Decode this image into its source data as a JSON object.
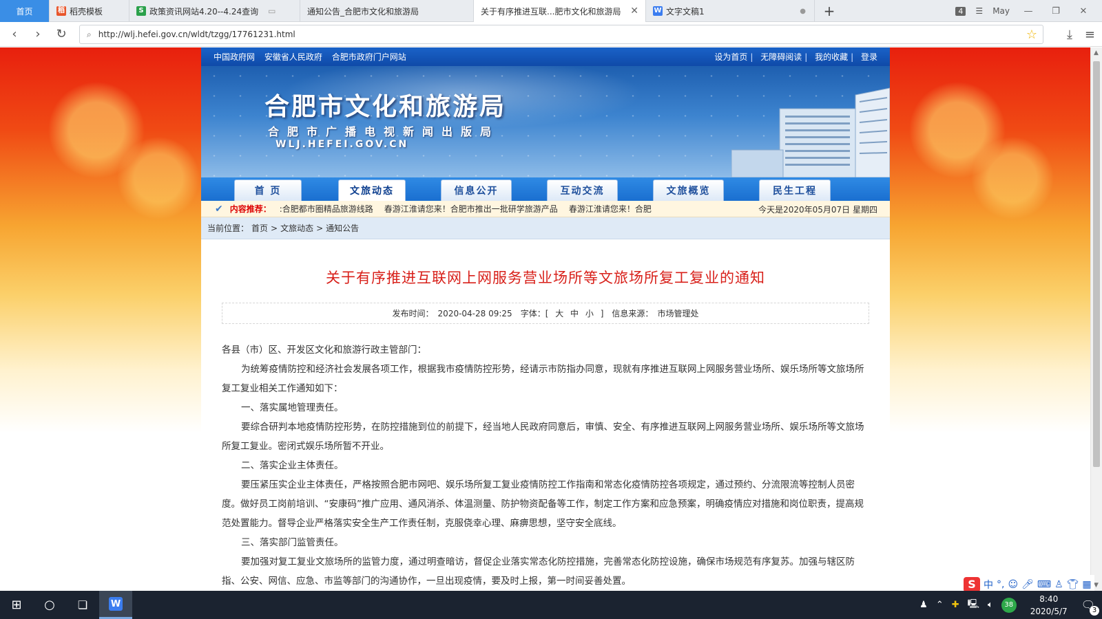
{
  "browser": {
    "tabs": [
      {
        "label": "首页",
        "icon": "home-tab"
      },
      {
        "label": "稻壳模板",
        "icon": "docer-icon"
      },
      {
        "label": "政策资讯网站4.20--4.24查询",
        "icon": "spreadsheet-icon"
      },
      {
        "label": "通知公告_合肥市文化和旅游局",
        "icon": "page-icon"
      },
      {
        "label": "关于有序推进互联...肥市文化和旅游局",
        "icon": "page-icon"
      },
      {
        "label": "文字文稿1",
        "icon": "writer-icon"
      }
    ],
    "new_tab": "+",
    "tab_count": "4",
    "account": "May",
    "url": "http://wlj.hefei.gov.cn/wldt/tzgg/17761231.html"
  },
  "site": {
    "top_links": [
      "中国政府网",
      "安徽省人民政府",
      "合肥市政府门户网站"
    ],
    "top_right": [
      "设为首页",
      "无障碍阅读",
      "我的收藏",
      "登录"
    ],
    "banner": {
      "title": "合肥市文化和旅游局",
      "subtitle": "合肥市广播电视新闻出版局",
      "domain": "WLJ.HEFEI.GOV.CN"
    },
    "nav": [
      "首 页",
      "文旅动态",
      "信息公开",
      "互动交流",
      "文旅概览",
      "民生工程"
    ],
    "nav_active_index": 1,
    "ticker": {
      "label": "内容推荐：",
      "items": [
        ":合肥都市圈精品旅游线路",
        "春游江淮请您来！合肥市推出一批研学旅游产品",
        "春游江淮请您来！合肥"
      ],
      "date": "今天是2020年05月07日 星期四"
    },
    "breadcrumb": [
      "当前位置：",
      "首页",
      ">",
      "文旅动态",
      ">",
      "通知公告"
    ]
  },
  "article": {
    "title": "关于有序推进互联网上网服务营业场所等文旅场所复工复业的通知",
    "meta": {
      "publish_label": "发布时间：",
      "publish_time": "2020-04-28 09:25",
      "font_label": "字体：[",
      "font_sizes": [
        "大",
        "中",
        "小"
      ],
      "font_close": "]",
      "source_label": "信息来源：",
      "source": "市场管理处"
    },
    "paragraphs": [
      "各县（市）区、开发区文化和旅游行政主管部门：",
      "为统筹疫情防控和经济社会发展各项工作，根据我市疫情防控形势，经请示市防指办同意，现就有序推进互联网上网服务营业场所、娱乐场所等文旅场所复工复业相关工作通知如下：",
      "一、落实属地管理责任。",
      "要综合研判本地疫情防控形势，在防控措施到位的前提下，经当地人民政府同意后，审慎、安全、有序推进互联网上网服务营业场所、娱乐场所等文旅场所复工复业。密闭式娱乐场所暂不开业。",
      "二、落实企业主体责任。",
      "要压紧压实企业主体责任，严格按照合肥市网吧、娱乐场所复工复业疫情防控工作指南和常态化疫情防控各项规定，通过预约、分流限流等控制人员密度。做好员工岗前培训、“安康码”推广应用、通风消杀、体温测量、防护物资配备等工作，制定工作方案和应急预案，明确疫情应对措施和岗位职责，提高规范处置能力。督导企业严格落实安全生产工作责任制，克服侥幸心理、麻痹思想，坚守安全底线。",
      "三、落实部门监管责任。",
      "要加强对复工复业文旅场所的监管力度，通过明查暗访，督促企业落实常态化防控措施，完善常态化防控设施，确保市场规范有序复苏。加强与辖区防指、公安、网信、应急、市监等部门的沟通协作，一旦出现疫情，要及时上报，第一时间妥善处置。"
    ]
  },
  "ime": {
    "logo": "S",
    "mode": "中",
    "punct": "°,"
  },
  "taskbar": {
    "time": "8:40",
    "date": "2020/5/7",
    "badge": "38",
    "notifications": "3"
  }
}
